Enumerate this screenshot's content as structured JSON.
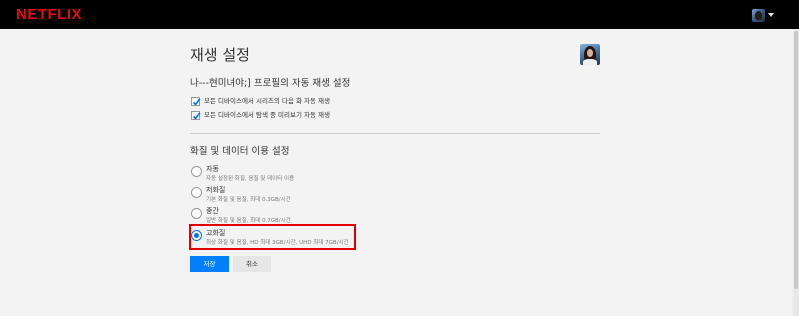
{
  "header": {
    "logo": "NETFLIX",
    "logo_color": "#e50914"
  },
  "page": {
    "title": "재생 설정"
  },
  "autoplay": {
    "title": "나---현미녀야;] 프로필의 자동 재생 설정",
    "options": [
      {
        "label": "모든 디바이스에서 시리즈의 다음 화 자동 재생",
        "checked": true
      },
      {
        "label": "모든 디바이스에서 탐색 중 미리보기 자동 재생",
        "checked": true
      }
    ]
  },
  "quality": {
    "title": "화질 및 데이터 이용 설정",
    "options": [
      {
        "label": "자동",
        "desc": "자동 설정된 화질, 음질 및 데이터 이용",
        "selected": false
      },
      {
        "label": "저화질",
        "desc": "기본 화질 및 음질, 최대 0.3GB/시간",
        "selected": false
      },
      {
        "label": "중간",
        "desc": "일반 화질 및 음질, 최대 0.7GB/시간",
        "selected": false
      },
      {
        "label": "고화질",
        "desc": "최상 화질 및 음질, HD 최대 3GB/시간, UHD 최대 7GB/시간",
        "selected": true
      }
    ]
  },
  "buttons": {
    "save": "저장",
    "cancel": "취소"
  },
  "colors": {
    "accent": "#0071eb",
    "save_button": "#0080ff",
    "highlight_box": "#e00000"
  }
}
